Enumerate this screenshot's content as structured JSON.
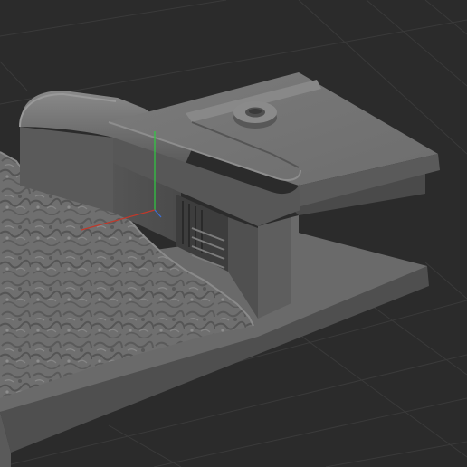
{
  "viewport": {
    "background": "#2b2b2b",
    "grid_color": "#3a3a3a",
    "model_color": "#6a6a6a"
  },
  "gizmo": {
    "x_axis_color": "#c0392b",
    "y_axis_color": "#2ecc40",
    "z_axis_color": "#3b6fd8"
  }
}
